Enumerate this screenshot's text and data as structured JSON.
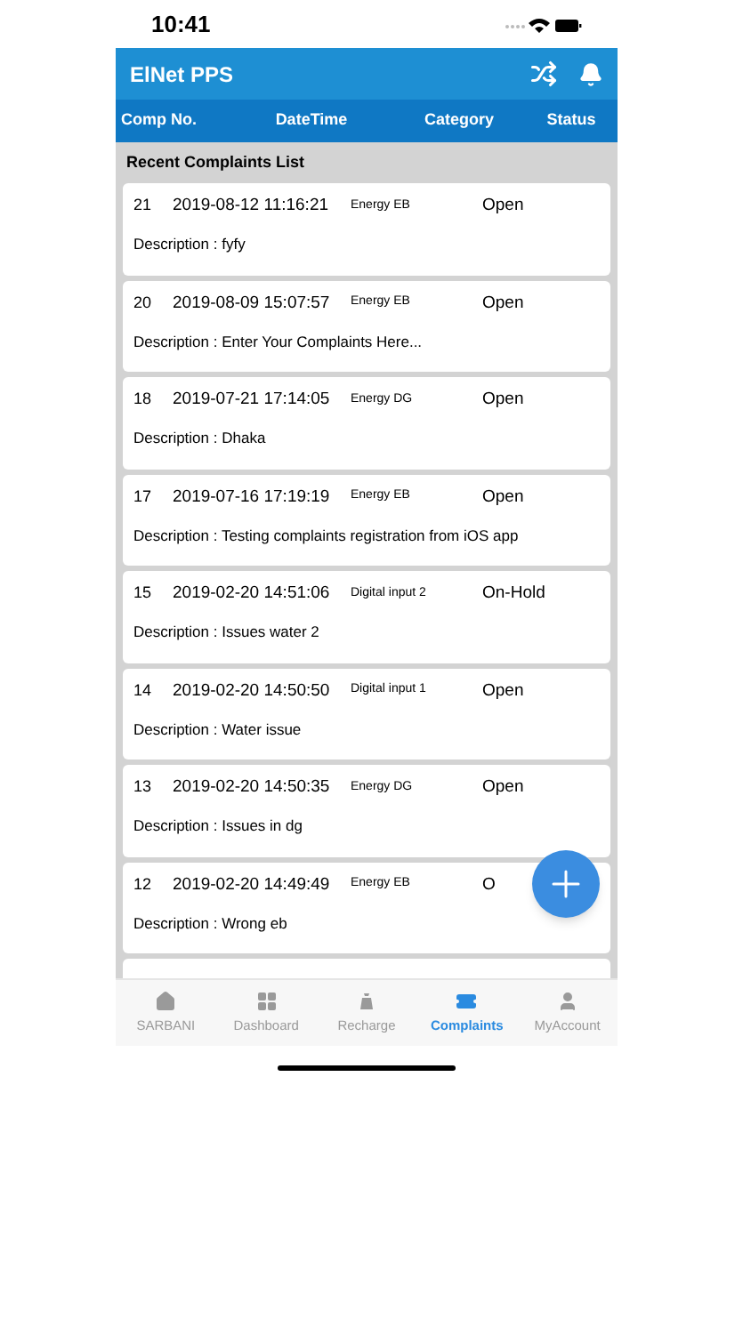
{
  "status_bar": {
    "time": "10:41"
  },
  "app_bar": {
    "title": "ElNet PPS"
  },
  "columns": [
    "Comp No.",
    "DateTime",
    "Category",
    "Status"
  ],
  "list_title": "Recent Complaints List",
  "complaints": [
    {
      "no": "21",
      "datetime": "2019-08-12 11:16:21",
      "category": "Energy EB",
      "status": "Open",
      "description": "Description : fyfy"
    },
    {
      "no": "20",
      "datetime": "2019-08-09 15:07:57",
      "category": "Energy EB",
      "status": "Open",
      "description": "Description : Enter Your Complaints Here..."
    },
    {
      "no": "18",
      "datetime": "2019-07-21 17:14:05",
      "category": "Energy DG",
      "status": "Open",
      "description": "Description : Dhaka"
    },
    {
      "no": "17",
      "datetime": "2019-07-16 17:19:19",
      "category": "Energy EB",
      "status": "Open",
      "description": "Description : Testing complaints registration from iOS app"
    },
    {
      "no": "15",
      "datetime": "2019-02-20 14:51:06",
      "category": "Digital input 2",
      "status": "On-Hold",
      "description": "Description : Issues water 2"
    },
    {
      "no": "14",
      "datetime": "2019-02-20 14:50:50",
      "category": "Digital input 1",
      "status": "Open",
      "description": "Description : Water issue"
    },
    {
      "no": "13",
      "datetime": "2019-02-20 14:50:35",
      "category": "Energy DG",
      "status": "Open",
      "description": "Description : Issues in dg"
    },
    {
      "no": "12",
      "datetime": "2019-02-20 14:49:49",
      "category": "Energy EB",
      "status": "O",
      "description": "Description : Wrong eb"
    }
  ],
  "tabs": [
    {
      "label": "SARBANI",
      "kind": "home",
      "selected": false
    },
    {
      "label": "Dashboard",
      "kind": "dashboard",
      "selected": false
    },
    {
      "label": "Recharge",
      "kind": "recharge",
      "selected": false
    },
    {
      "label": "Complaints",
      "kind": "complaints",
      "selected": true
    },
    {
      "label": "MyAccount",
      "kind": "account",
      "selected": false
    }
  ]
}
